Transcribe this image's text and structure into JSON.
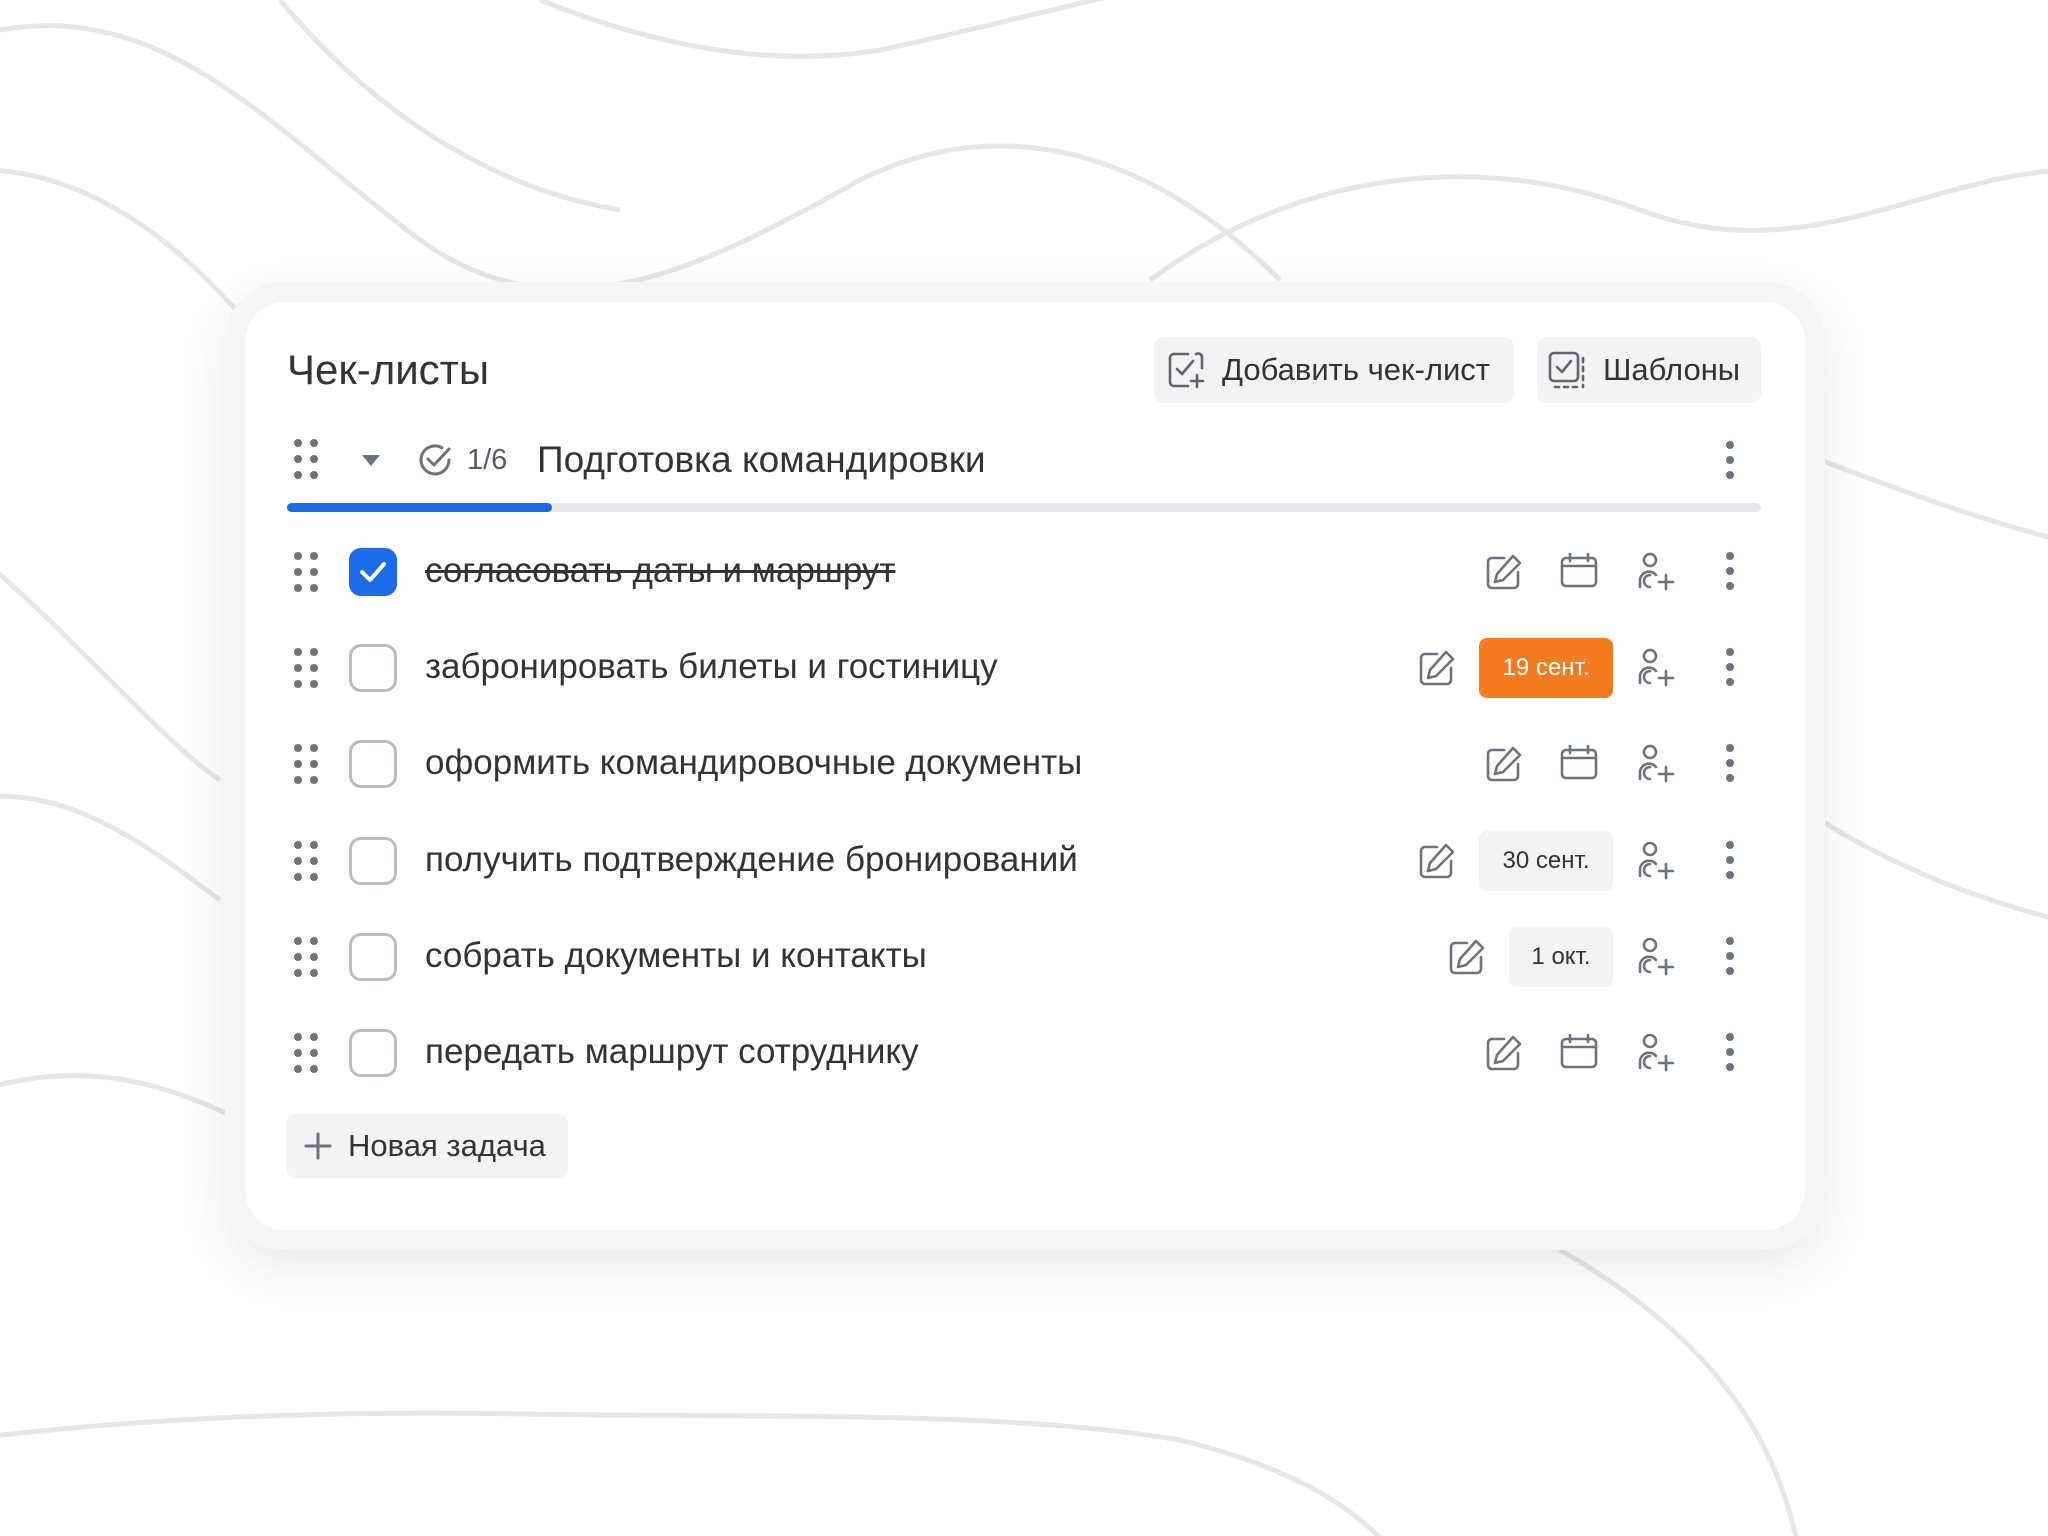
{
  "header": {
    "title": "Чек-листы",
    "add_checklist_label": "Добавить чек-лист",
    "templates_label": "Шаблоны"
  },
  "checklist": {
    "progress_text": "1/6",
    "progress_fraction": 0.18,
    "title": "Подготовка командировки",
    "tasks": [
      {
        "text": "согласовать даты и маршрут",
        "done": true,
        "date": ""
      },
      {
        "text": "забронировать билеты и гостиницу",
        "done": false,
        "date": "19 сент.",
        "date_status": "overdue"
      },
      {
        "text": "оформить командировочные документы",
        "done": false,
        "date": ""
      },
      {
        "text": "получить подтверждение бронирований",
        "done": false,
        "date": "30 сент.",
        "date_status": "normal"
      },
      {
        "text": "собрать документы и контакты",
        "done": false,
        "date": "1 окт.",
        "date_status": "normal"
      },
      {
        "text": "передать маршрут сотруднику",
        "done": false,
        "date": ""
      }
    ]
  },
  "new_task_label": "Новая задача",
  "colors": {
    "accent": "#1a6ce8",
    "overdue": "#f47c20",
    "text": "#333333",
    "icon": "#6b7280"
  },
  "icons": {
    "add_checklist": "checklist-plus-icon",
    "templates": "checklist-template-icon",
    "drag": "drag-handle-icon",
    "collapse": "caret-down-icon",
    "progress": "check-circle-icon",
    "edit": "pencil-icon",
    "calendar": "calendar-icon",
    "assign": "user-plus-icon",
    "more": "more-vertical-icon",
    "add": "plus-icon"
  }
}
